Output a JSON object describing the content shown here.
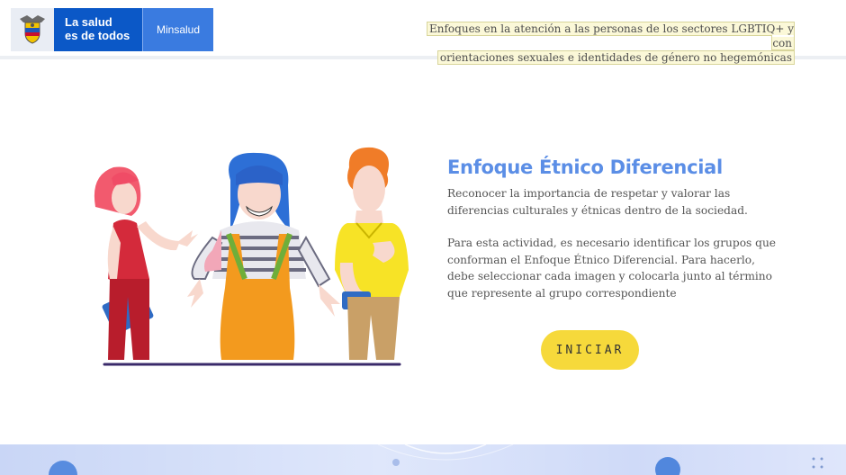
{
  "header": {
    "logo": {
      "line1": "La salud",
      "line2": "es de todos",
      "ministry": "Minsalud"
    },
    "course_title_line1": "Enfoques en la atención a las personas de los sectores LGBTIQ+ y con",
    "course_title_line2": "orientaciones sexuales e identidades de género no hegemónicas"
  },
  "main": {
    "title": "Enfoque Étnico Diferencial",
    "intro": "Reconocer la importancia de respetar y valorar las diferencias culturales y étnicas dentro de la sociedad.",
    "instructions": "Para esta actividad, es necesario identificar los grupos que conforman el Enfoque Étnico Diferencial. Para hacerlo, debe seleccionar cada imagen y colocarla junto al término que represente al grupo correspondiente",
    "start_label": "INICIAR"
  },
  "colors": {
    "brand_blue": "#0b58c7",
    "title_blue": "#5b8ee6",
    "button_yellow": "#f6d93b"
  }
}
